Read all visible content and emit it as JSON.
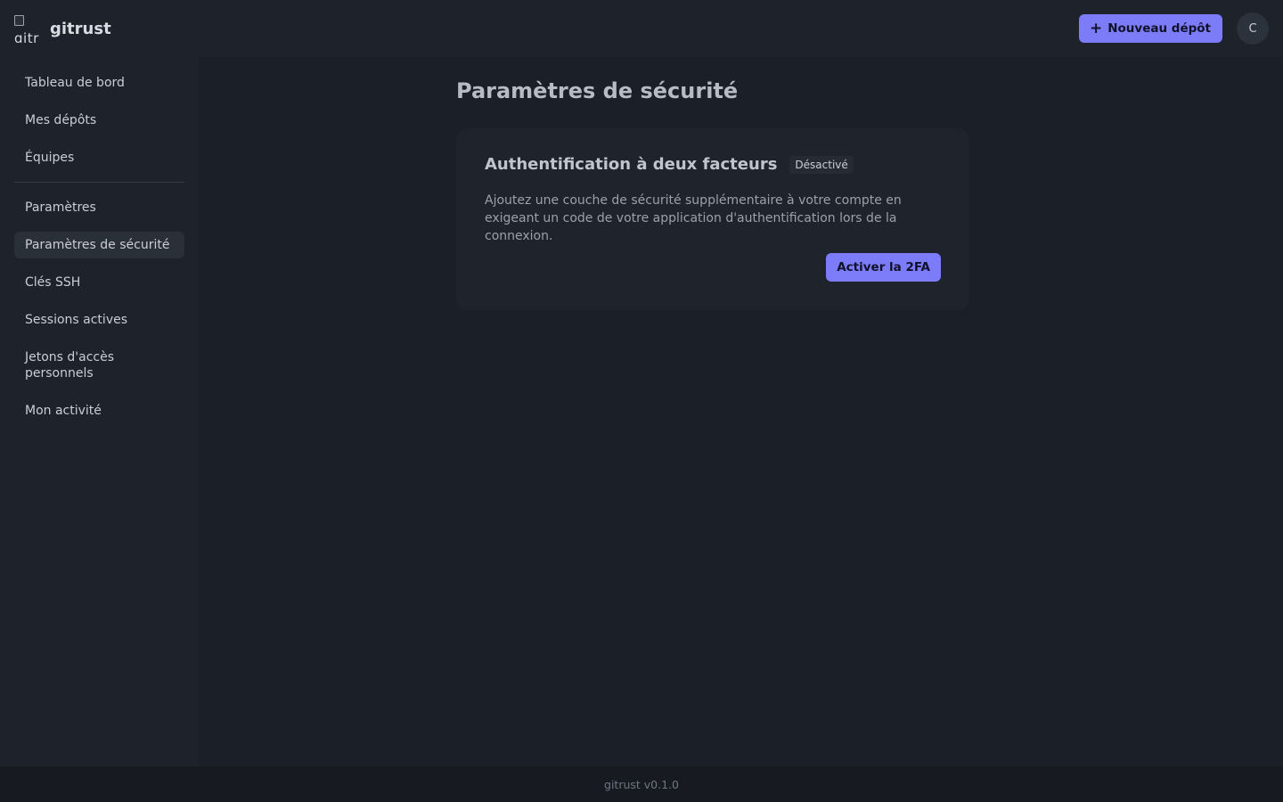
{
  "header": {
    "brand_name": "gitrust",
    "logo_alt": "gitr",
    "new_repo_label": "Nouveau dépôt",
    "avatar_initial": "C"
  },
  "sidebar": {
    "items": [
      {
        "label": "Tableau de bord"
      },
      {
        "label": "Mes dépôts"
      },
      {
        "label": "Équipes"
      },
      {
        "label": "Paramètres"
      },
      {
        "label": "Paramètres de sécurité",
        "active": true
      },
      {
        "label": "Clés SSH"
      },
      {
        "label": "Sessions actives"
      },
      {
        "label": "Jetons d'accès personnels"
      },
      {
        "label": "Mon activité"
      }
    ]
  },
  "main": {
    "page_title": "Paramètres de sécurité",
    "two_factor": {
      "title": "Authentification à deux facteurs",
      "status": "Désactivé",
      "description": "Ajoutez une couche de sécurité supplémentaire à votre compte en exigeant un code de votre application d'authentification lors de la connexion.",
      "button_label": "Activer la 2FA"
    }
  },
  "footer": {
    "version": "gitrust v0.1.0"
  },
  "colors": {
    "accent": "#7c7cf8",
    "background": "#1b1f27",
    "surface": "#1e232b"
  }
}
